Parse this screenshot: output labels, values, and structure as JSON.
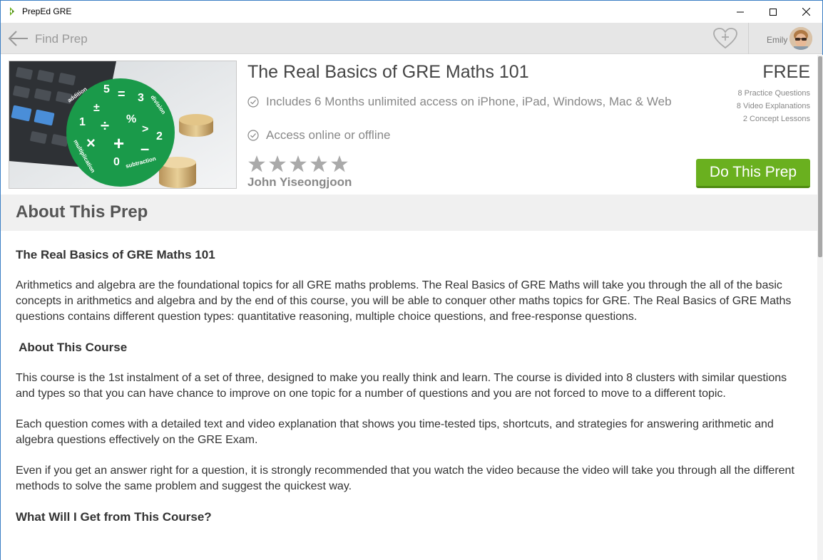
{
  "window": {
    "title": "PrepEd GRE",
    "controls": {
      "minimize_icon": "minimize-icon",
      "maximize_icon": "maximize-icon",
      "close_icon": "close-icon"
    }
  },
  "nav": {
    "back_label": "Find Prep",
    "user_name": "Emily",
    "icons": {
      "back": "arrow-left-icon",
      "favorite": "heart-plus-icon",
      "avatar": "user-avatar"
    }
  },
  "prep": {
    "title": "The Real Basics of GRE Maths 101",
    "price": "FREE",
    "features": [
      "Includes 6 Months unlimited access on iPhone, iPad, Windows, Mac & Web",
      "Access online or offline"
    ],
    "stats": [
      "8 Practice Questions",
      "8 Video Explanations",
      "2 Concept Lessons"
    ],
    "rating_stars": 5,
    "author": "John Yiseongjoon",
    "cta_label": "Do This Prep",
    "thumbnail_words": [
      "addition",
      "division",
      "multiplication",
      "subtraction"
    ],
    "thumbnail_symbols": [
      "5",
      "=",
      "3",
      "±",
      "%",
      "1",
      "÷",
      ">",
      "2",
      "×",
      "+",
      "–",
      "0"
    ]
  },
  "about": {
    "heading": "About This Prep",
    "sections": [
      {
        "type": "heading",
        "text": "The Real Basics of GRE Maths 101"
      },
      {
        "type": "paragraph",
        "text": "Arithmetics and algebra are the foundational topics for all GRE maths problems. The Real Basics of GRE Maths will take you through the all of the basic concepts in arithmetics and algebra and by the end of this course, you will be able to conquer other maths topics for GRE. The Real Basics of GRE Maths questions contains different question types: quantitative reasoning, multiple choice questions, and free-response questions."
      },
      {
        "type": "heading",
        "text": " About This Course"
      },
      {
        "type": "paragraph",
        "text": "This course is the 1st instalment of a set of three, designed to make you really think and learn. The course is divided into 8 clusters with similar questions and types so that you can have chance to improve on one topic for a number of questions and you are not forced to move to a different topic."
      },
      {
        "type": "paragraph",
        "text": "Each question comes with a detailed text and video explanation that shows you time-tested tips, shortcuts, and strategies for answering arithmetic and algebra questions effectively on the GRE Exam."
      },
      {
        "type": "paragraph",
        "text": "Even if you get an answer right for a question, it is strongly recommended that you watch the video because the video will take you through all the different methods to solve the same problem and suggest the quickest way."
      },
      {
        "type": "heading",
        "text": "What Will I Get from This Course?"
      }
    ]
  },
  "colors": {
    "accent_green": "#6ab01f",
    "window_border": "#3c7fc4",
    "nav_bg": "#e6e6e6",
    "about_band_bg": "#f0f0f0"
  }
}
